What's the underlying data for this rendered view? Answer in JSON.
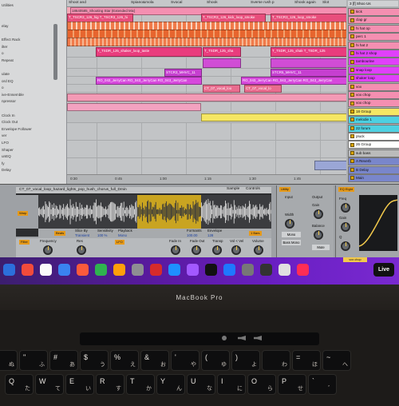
{
  "browser": {
    "items": [
      "Utilities",
      "",
      "",
      "elay",
      "",
      "Effect Rack",
      "ilter",
      "o",
      "Repeat",
      "",
      "ulate",
      "ord EQ",
      "o",
      "ive-Ensemble",
      "npressor",
      "",
      "Clock In",
      "Clock Out",
      "Envelope Follower",
      "ver",
      "LFO",
      "Shaper",
      "unEQ",
      "fy",
      "Delay"
    ]
  },
  "arrangement": {
    "top_labels": [
      "Shoot and",
      "Spiano&mola",
      "Svocal",
      "Shook",
      "Sverse rush p",
      "Shook again",
      "Shook again",
      "Slot"
    ],
    "clips": [
      {
        "text": "18640585_Shooting Star (Extended Mix)"
      },
      {
        "text": "T_TSCR3_126_hig T_TSCR3_126_hi"
      },
      {
        "text": "T_TSCR3_126_kick_loop_smoke"
      },
      {
        "text": "T_TSCR3_126_loop_smoke"
      },
      {
        "text": "T_TSCR3_126_loop_smoke"
      },
      {
        "text": "T_TSDR_125_shaker_loop_taste"
      },
      {
        "text": "T_TSDR_125_sha T_TSDR_125_sha"
      },
      {
        "text": "T_TSDR_125_sha"
      },
      {
        "text": "T_TSDR_125_shak T_TSDR_125"
      },
      {
        "text": "STCR3_MHVC_11"
      },
      {
        "text": "STCR5_MHVC_11"
      },
      {
        "text": "RO_043_JerryCan RO_043_JerryCan RO_043_JerryCan"
      },
      {
        "text": "RO_043_JerryCan RO_043_JerryCan RO_043_JerryCan"
      },
      {
        "text": "CT_07_vocal_loo"
      },
      {
        "text": "CT_07_vocal_lo"
      }
    ],
    "time_labels": [
      "0:30",
      "0:45",
      "1:00",
      "1:15",
      "1:30",
      "1:45"
    ]
  },
  "tracks": [
    {
      "label": "kick",
      "color": "#f48fb1"
    },
    {
      "label": "clap gr",
      "color": "#f48fb1"
    },
    {
      "label": "hi hat op",
      "color": "#f48fb1"
    },
    {
      "label": "perc 1",
      "color": "#f48fb1"
    },
    {
      "label": "hi hat 2",
      "color": "#f48fb1"
    },
    {
      "label": "hi hat 2 shop",
      "color": "#e040fb"
    },
    {
      "label": "tambourine",
      "color": "#e040fb"
    },
    {
      "label": "snap loop",
      "color": "#e040fb"
    },
    {
      "label": "shaker loop",
      "color": "#e040fb"
    },
    {
      "label": "vox",
      "color": "#f48fb1"
    },
    {
      "label": "vox chop",
      "color": "#f48fb1"
    },
    {
      "label": "vox chop",
      "color": "#f48fb1"
    },
    {
      "label": "18 Group",
      "color": "#f5e663"
    },
    {
      "label": "melodie 1",
      "color": "#4dd0e1"
    },
    {
      "label": "22 forum",
      "color": "#4dd0e1"
    },
    {
      "label": "pluck",
      "color": "#ffffff"
    },
    {
      "label": "26 Group",
      "color": "#ffffff"
    },
    {
      "label": "sub bass",
      "color": "#bbbbbb"
    },
    {
      "label": "A Reverb",
      "color": "#7986cb"
    },
    {
      "label": "B Delay",
      "color": "#7986cb"
    },
    {
      "label": "Main",
      "color": "#7986cb"
    }
  ],
  "track_header": {
    "title": "3 [f] Shoo Us"
  },
  "detail": {
    "clip_title": "CT_07_vocal_loop_hazard_lights_pop_hush_chorus_full_Dmin",
    "sample_label": "Sample",
    "controls_label": "Controls",
    "fields": {
      "warp": "Warp",
      "beats": "Beats",
      "slice_by": "Slice By",
      "transient": "Transient",
      "sensitivity": "Sensitivity",
      "sensitivity_val": "100 %",
      "playback": "Playback",
      "playback_val": "Mono",
      "formants": "Formants",
      "formants_val": "100.00",
      "envelope": "Envelope",
      "envelope_val": "128",
      "bars": "1 Bars",
      "filter": "Filter",
      "frequency": "Frequency",
      "res": "Res",
      "lfo": "LFO",
      "fade_in": "Fade In",
      "fade_out": "Fade Out",
      "transp": "Transp",
      "vol_vel": "Vol < Vel",
      "volume": "Volume"
    },
    "utility": {
      "title": "Utility",
      "input": "Input",
      "output": "Output",
      "gain": "Gain",
      "width": "Width",
      "mono": "Mono",
      "bass_mono": "Bass Mono",
      "balance": "Balance",
      "mute": "Mute",
      "dc": "DC"
    },
    "eq": {
      "title": "EQ Eight",
      "freq": "Freq",
      "gain": "Gain",
      "q": "Q"
    }
  },
  "dock": {
    "label": "Live",
    "vox_chop_badge": "vox chop"
  },
  "laptop": {
    "brand": "MacBook Pro"
  },
  "keyboard": {
    "row1": [
      {
        "main": "!",
        "sub": "ぬ",
        "main2": "1"
      },
      {
        "main": "\"",
        "sub": "ふ",
        "main2": "2"
      },
      {
        "main": "#",
        "sub": "あ",
        "main2": "3"
      },
      {
        "main": "$",
        "sub": "う",
        "main2": "4"
      },
      {
        "main": "%",
        "sub": "え",
        "main2": "5"
      },
      {
        "main": "&",
        "sub": "お",
        "main2": "6"
      },
      {
        "main": "'",
        "sub": "や",
        "main2": "7"
      },
      {
        "main": "(",
        "sub": "ゆ",
        "main2": "8"
      },
      {
        "main": ")",
        "sub": "よ",
        "main2": "9"
      },
      {
        "main": "",
        "sub": "わ",
        "main2": "0"
      },
      {
        "main": "=",
        "sub": "ほ",
        "main2": "-"
      },
      {
        "main": "~",
        "sub": "へ",
        "main2": "^"
      }
    ],
    "row2": [
      {
        "main": "Q",
        "sub": "た"
      },
      {
        "main": "W",
        "sub": "て"
      },
      {
        "main": "E",
        "sub": "い"
      },
      {
        "main": "R",
        "sub": "す"
      },
      {
        "main": "T",
        "sub": "か"
      },
      {
        "main": "Y",
        "sub": "ん"
      },
      {
        "main": "U",
        "sub": "な"
      },
      {
        "main": "I",
        "sub": "に"
      },
      {
        "main": "O",
        "sub": "ら"
      },
      {
        "main": "P",
        "sub": "せ"
      },
      {
        "main": "`",
        "sub": "゛"
      }
    ]
  }
}
